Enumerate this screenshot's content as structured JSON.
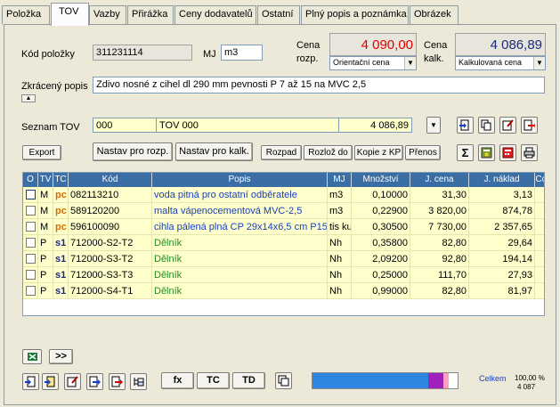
{
  "tabs": [
    "Položka",
    "TOV",
    "Vazby",
    "Přirážka",
    "Ceny dodavatelů",
    "Ostatní",
    "Plný popis a poznámka",
    "Obrázek"
  ],
  "kod_polozky": {
    "label": "Kód položky",
    "value": "311231114"
  },
  "mj": {
    "label": "MJ",
    "value": "m3"
  },
  "cena_rozp": {
    "label_1": "Cena",
    "label_2": "rozp.",
    "value": "4 090,00",
    "select": "Orientační cena"
  },
  "cena_kalk": {
    "label_1": "Cena",
    "label_2": "kalk.",
    "value": "4 086,89",
    "select": "Kalkulovaná cena"
  },
  "zkraceny_popis": {
    "label": "Zkrácený popis",
    "value": "Zdivo nosné z cihel dl 290 mm pevnosti P 7 až 15 na MVC 2,5"
  },
  "seznam_tov": {
    "label": "Seznam TOV",
    "code": "000",
    "name": "TOV 000",
    "amount": "4 086,89"
  },
  "toolbar": {
    "export": "Export",
    "nastav_rozp": "Nastav pro rozp.",
    "nastav_kalk": "Nastav pro kalk.",
    "rozpad": "Rozpad",
    "rozloz": "Rozlož do",
    "kopie": "Kopie z KP",
    "prenos": "Přenos",
    "sigma": "Σ"
  },
  "grid": {
    "headers": [
      "O",
      "TV",
      "TC",
      "Kód",
      "Popis",
      "MJ",
      "Množství",
      "J. cena",
      "J. náklad",
      "Cc"
    ],
    "rows": [
      {
        "tv": "M",
        "tc": "pc",
        "kod": "082113210",
        "popis": "voda pitná pro ostatní odběratele",
        "mj": "m3",
        "mnozstvi": "0,10000",
        "jcena": "31,30",
        "jnaklad": "3,13"
      },
      {
        "tv": "M",
        "tc": "pc",
        "kod": "589120200",
        "popis": "malta vápenocementová MVC-2,5",
        "mj": "m3",
        "mnozstvi": "0,22900",
        "jcena": "3 820,00",
        "jnaklad": "874,78"
      },
      {
        "tv": "M",
        "tc": "pc",
        "kod": "596100090",
        "popis": "cihla pálená plná CP 29x14x6,5 cm P15",
        "mj": "tis ku",
        "mnozstvi": "0,30500",
        "jcena": "7 730,00",
        "jnaklad": "2 357,65"
      },
      {
        "tv": "P",
        "tc": "s1",
        "kod": "712000-S2-T2",
        "popis": "Dělník",
        "mj": "Nh",
        "mnozstvi": "0,35800",
        "jcena": "82,80",
        "jnaklad": "29,64"
      },
      {
        "tv": "P",
        "tc": "s1",
        "kod": "712000-S3-T2",
        "popis": "Dělník",
        "mj": "Nh",
        "mnozstvi": "2,09200",
        "jcena": "92,80",
        "jnaklad": "194,14"
      },
      {
        "tv": "P",
        "tc": "s1",
        "kod": "712000-S3-T3",
        "popis": "Dělník",
        "mj": "Nh",
        "mnozstvi": "0,25000",
        "jcena": "111,70",
        "jnaklad": "27,93"
      },
      {
        "tv": "P",
        "tc": "s1",
        "kod": "712000-S4-T1",
        "popis": "Dělník",
        "mj": "Nh",
        "mnozstvi": "0,99000",
        "jcena": "82,80",
        "jnaklad": "81,97"
      }
    ]
  },
  "bottom": {
    "next": ">>",
    "fx": "fx",
    "tc": "TC",
    "td": "TD",
    "celkem_label": "Celkem",
    "celkem_pct": "100,00 %",
    "celkem_value": "4 087"
  },
  "colors": {
    "price_red": "#e00000",
    "price_blue": "#1a2a7a",
    "grid_header": "#3a6ea5",
    "row_bg": "#ffffcc"
  }
}
